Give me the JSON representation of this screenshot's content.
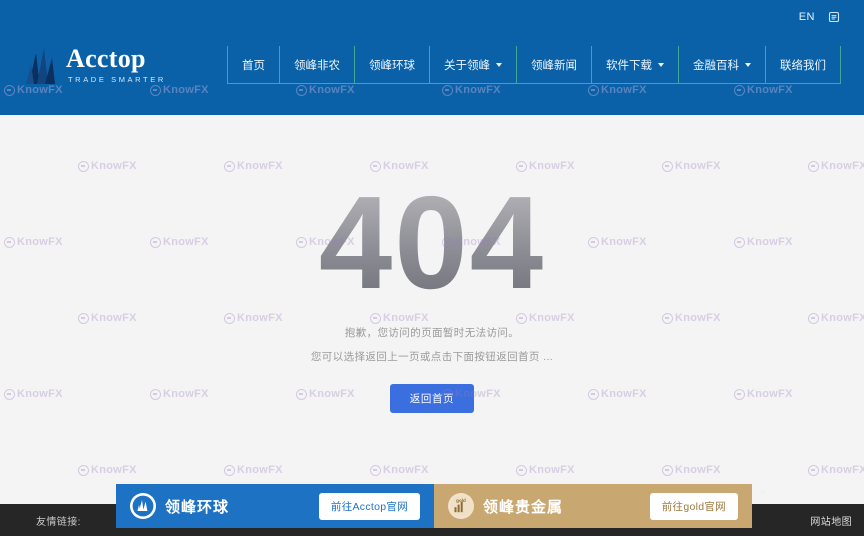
{
  "header": {
    "brand": {
      "name": "Acctop",
      "tagline": "TRADE SMARTER",
      "logo_icon": "mountain-logo-icon"
    },
    "lang_label": "EN",
    "top_icon": "user-account-icon",
    "nav": [
      {
        "label": "首页",
        "caret": false
      },
      {
        "label": "领峰非农",
        "caret": false
      },
      {
        "label": "领峰环球",
        "caret": false
      },
      {
        "label": "关于领峰",
        "caret": true
      },
      {
        "label": "领峰新闻",
        "caret": false
      },
      {
        "label": "软件下载",
        "caret": true
      },
      {
        "label": "金融百科",
        "caret": true
      },
      {
        "label": "联络我们",
        "caret": false
      }
    ]
  },
  "main": {
    "error_code": "404",
    "message_line1": "抱歉，您访问的页面暂时无法访问。",
    "message_line2": "您可以选择返回上一页或点击下面按钮返回首页 ...",
    "home_button": "返回首页"
  },
  "footer": {
    "friend_links_label": "友情链接:",
    "sitemap_label": "网站地图"
  },
  "promos": [
    {
      "title": "领峰环球",
      "cta": "前往Acctop官网",
      "logo_icon": "acctop-circle-icon",
      "color": "#1d72c4"
    },
    {
      "title": "领峰贵金属",
      "cta": "前往gold官网",
      "logo_icon": "gold-circle-icon",
      "color": "#c9a770"
    }
  ],
  "promo_close_label": "×",
  "watermark": {
    "text": "KnowFX",
    "mark_icon": "knowfx-circle-icon"
  },
  "colors": {
    "header_blue": "#0a61a8",
    "nav_divider": "#3fa89b",
    "page_background": "#f4f4f4",
    "button_blue": "#3b6fe0",
    "footer_dark": "#262626"
  }
}
